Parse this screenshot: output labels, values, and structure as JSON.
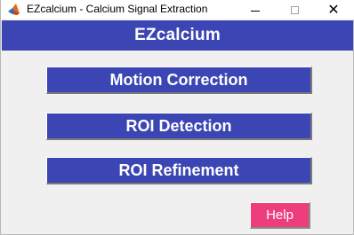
{
  "window": {
    "title": "EZcalcium - Calcium Signal Extraction",
    "app_icon": "matlab-icon"
  },
  "window_controls": {
    "minimize_icon": "minimize-icon",
    "maximize_icon": "maximize-icon",
    "close_icon": "close-icon",
    "close_glyph": "✕"
  },
  "header": {
    "title": "EZcalcium"
  },
  "buttons": {
    "motion_correction": "Motion Correction",
    "roi_detection": "ROI Detection",
    "roi_refinement": "ROI Refinement",
    "help": "Help"
  },
  "colors": {
    "panel_blue": "#3b45b3",
    "help_pink": "#ee3d7d",
    "background": "#f0f0f0"
  }
}
